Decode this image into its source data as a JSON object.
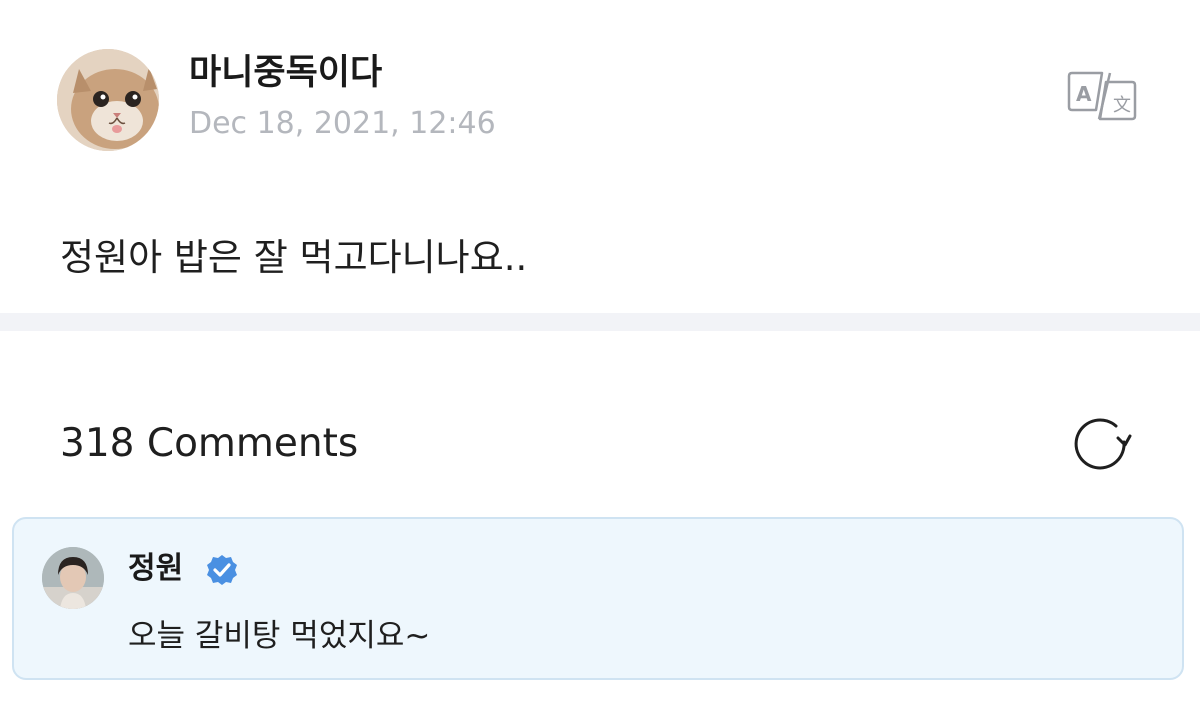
{
  "post": {
    "author_name": "마니중독이다",
    "date": "Dec 18, 2021, 12:46",
    "body": "정원아 밥은 잘 먹고다니나요..",
    "avatar_icon": "cat-avatar-icon",
    "translate_icon": "translate-icon"
  },
  "comments": {
    "count_label": "318 Comments",
    "refresh_icon": "refresh-icon",
    "items": [
      {
        "author": "정원",
        "verified": true,
        "text": "오늘 갈비탕 먹었지요~",
        "highlight_color": "#eef7fd",
        "badge_color": "#4a90e2"
      }
    ]
  },
  "colors": {
    "text_primary": "#1f1f1f",
    "text_muted": "#b4b7bd",
    "divider": "#f2f3f7",
    "card_border": "#cfe3f2"
  }
}
